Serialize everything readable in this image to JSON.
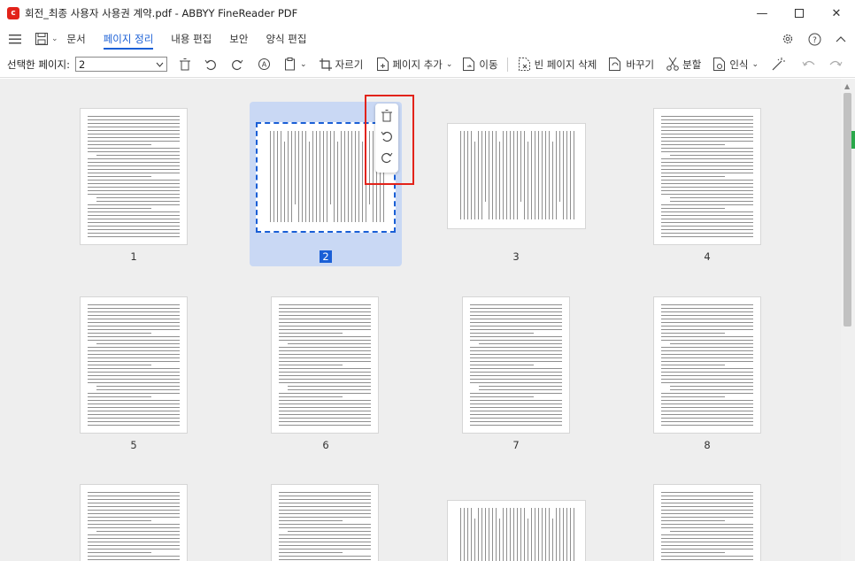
{
  "window": {
    "title": "회전_최종 사용자 사용권 계약.pdf - ABBYY FineReader PDF",
    "app_icon": "abbyy-logo-icon",
    "controls": [
      "minimize-icon",
      "maximize-icon",
      "close-icon"
    ]
  },
  "menu": {
    "tabs": [
      {
        "label": "문서",
        "active": false
      },
      {
        "label": "페이지 정리",
        "active": true
      },
      {
        "label": "내용 편집",
        "active": false
      },
      {
        "label": "보안",
        "active": false
      },
      {
        "label": "양식 편집",
        "active": false
      }
    ]
  },
  "toolbar": {
    "selected_pages_label": "선택한 페이지:",
    "selected_pages_value": "2",
    "crop_label": "자르기",
    "add_page_label": "페이지 추가",
    "move_label": "이동",
    "delete_blank_label": "빈 페이지 삭제",
    "replace_label": "바꾸기",
    "split_label": "분할",
    "recognize_label": "인식"
  },
  "pages": [
    {
      "number": "1",
      "selected": false,
      "layout": "portrait"
    },
    {
      "number": "2",
      "selected": true,
      "layout": "landscape-rotated"
    },
    {
      "number": "3",
      "selected": false,
      "layout": "landscape-rotated"
    },
    {
      "number": "4",
      "selected": false,
      "layout": "portrait"
    },
    {
      "number": "5",
      "selected": false,
      "layout": "portrait"
    },
    {
      "number": "6",
      "selected": false,
      "layout": "portrait"
    },
    {
      "number": "7",
      "selected": false,
      "layout": "portrait"
    },
    {
      "number": "8",
      "selected": false,
      "layout": "portrait"
    }
  ],
  "page_context_menu": [
    "trash-icon",
    "rotate-left-icon",
    "rotate-right-icon"
  ],
  "colors": {
    "accent": "#1a5fd6",
    "selection_bg": "#c9d8f4",
    "highlight_box": "#e2231a",
    "content_bg": "#eeeeee"
  }
}
